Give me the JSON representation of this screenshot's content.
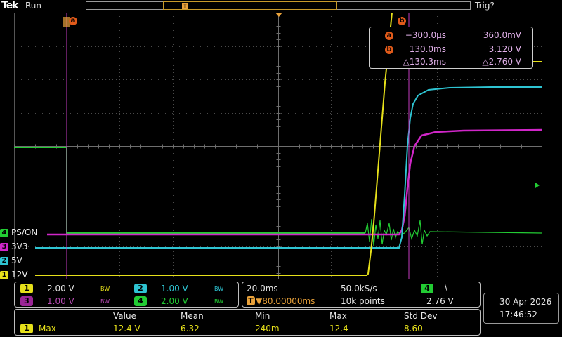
{
  "header": {
    "logo": "Tek",
    "run_state": "Run",
    "trigger_state": "Trig?"
  },
  "cursor_markers": {
    "a": "a",
    "b": "b"
  },
  "channel_labels": [
    {
      "num": "4",
      "name": "PS/ON",
      "color": "#22cc33"
    },
    {
      "num": "3",
      "name": "3V3",
      "color": "#d026c8"
    },
    {
      "num": "2",
      "name": "5V",
      "color": "#2ec4d2"
    },
    {
      "num": "1",
      "name": "12V",
      "color": "#e6e01a"
    }
  ],
  "cursor_readout": {
    "a": {
      "label": "a",
      "time": "−300.0µs",
      "value": "360.0mV"
    },
    "b": {
      "label": "b",
      "time": "130.0ms",
      "value": "3.120 V"
    },
    "delta": {
      "time": "△130.3ms",
      "value": "△2.760 V"
    }
  },
  "channel_settings": [
    {
      "num": "1",
      "scale": "2.00 V",
      "bw": "BW",
      "color": "#e6e01a",
      "scale_color": "#e6e6e6"
    },
    {
      "num": "2",
      "scale": "1.00 V",
      "bw": "BW",
      "color": "#2ec4d2",
      "scale_color": "#2ec4d2"
    },
    {
      "num": "3",
      "scale": "1.00 V",
      "bw": "BW",
      "color": "#9a2596",
      "scale_color": "#b74bb3"
    },
    {
      "num": "4",
      "scale": "2.00 V",
      "bw": "BW",
      "color": "#22cc33",
      "scale_color": "#22cc33"
    }
  ],
  "timebase": {
    "horizontal_scale": "20.0ms",
    "sample_rate": "50.0kS/s",
    "trigger_position": "▼80.00000ms",
    "record_length": "10k points"
  },
  "trigger": {
    "source": "4",
    "slope": "\\",
    "level": "2.76 V"
  },
  "datetime": {
    "date": "30 Apr 2026",
    "time": "17:46:52"
  },
  "measurements": {
    "headers": [
      "Value",
      "Mean",
      "Min",
      "Max",
      "Std Dev"
    ],
    "rows": [
      {
        "source": "1",
        "name": "Max",
        "values": [
          "12.4 V",
          "6.32",
          "240m",
          "12.4",
          "8.60"
        ]
      }
    ]
  },
  "colors": {
    "ch1": "#e6e01a",
    "ch2": "#2ec4d2",
    "ch3": "#d026c8",
    "ch4": "#22cc33",
    "cursor": "#e05a1a",
    "grid": "#5a5a5a"
  }
}
